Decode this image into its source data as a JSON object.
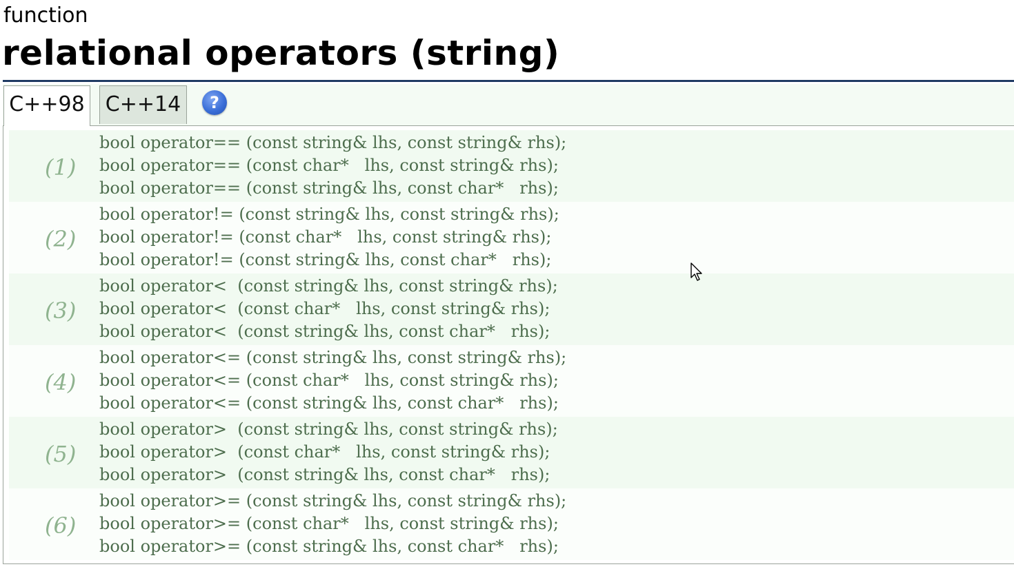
{
  "header": {
    "kind": "function",
    "title": "relational operators (string)"
  },
  "tabs": [
    {
      "label": "C++98",
      "active": true
    },
    {
      "label": "C++14",
      "active": false
    }
  ],
  "help_icon": {
    "glyph": "?",
    "icon": "help-icon",
    "color": "#3b6fd8"
  },
  "groups": [
    {
      "label": "(1)",
      "lines": [
        "bool operator== (const string& lhs, const string& rhs);",
        "bool operator== (const char*   lhs, const string& rhs);",
        "bool operator== (const string& lhs, const char*   rhs);"
      ]
    },
    {
      "label": "(2)",
      "lines": [
        "bool operator!= (const string& lhs, const string& rhs);",
        "bool operator!= (const char*   lhs, const string& rhs);",
        "bool operator!= (const string& lhs, const char*   rhs);"
      ]
    },
    {
      "label": "(3)",
      "lines": [
        "bool operator<  (const string& lhs, const string& rhs);",
        "bool operator<  (const char*   lhs, const string& rhs);",
        "bool operator<  (const string& lhs, const char*   rhs);"
      ]
    },
    {
      "label": "(4)",
      "lines": [
        "bool operator<= (const string& lhs, const string& rhs);",
        "bool operator<= (const char*   lhs, const string& rhs);",
        "bool operator<= (const string& lhs, const char*   rhs);"
      ]
    },
    {
      "label": "(5)",
      "lines": [
        "bool operator>  (const string& lhs, const string& rhs);",
        "bool operator>  (const char*   lhs, const string& rhs);",
        "bool operator>  (const string& lhs, const char*   rhs);"
      ]
    },
    {
      "label": "(6)",
      "lines": [
        "bool operator>= (const string& lhs, const string& rhs);",
        "bool operator>= (const char*   lhs, const string& rhs);",
        "bool operator>= (const string& lhs, const char*   rhs);"
      ]
    }
  ],
  "colors": {
    "title_rule": "#1f3a63",
    "code_text": "#4d6d4d",
    "group_label": "#8fb38f",
    "row_tint": "#f1faf1",
    "tab_bar": "#f4fbf4"
  }
}
